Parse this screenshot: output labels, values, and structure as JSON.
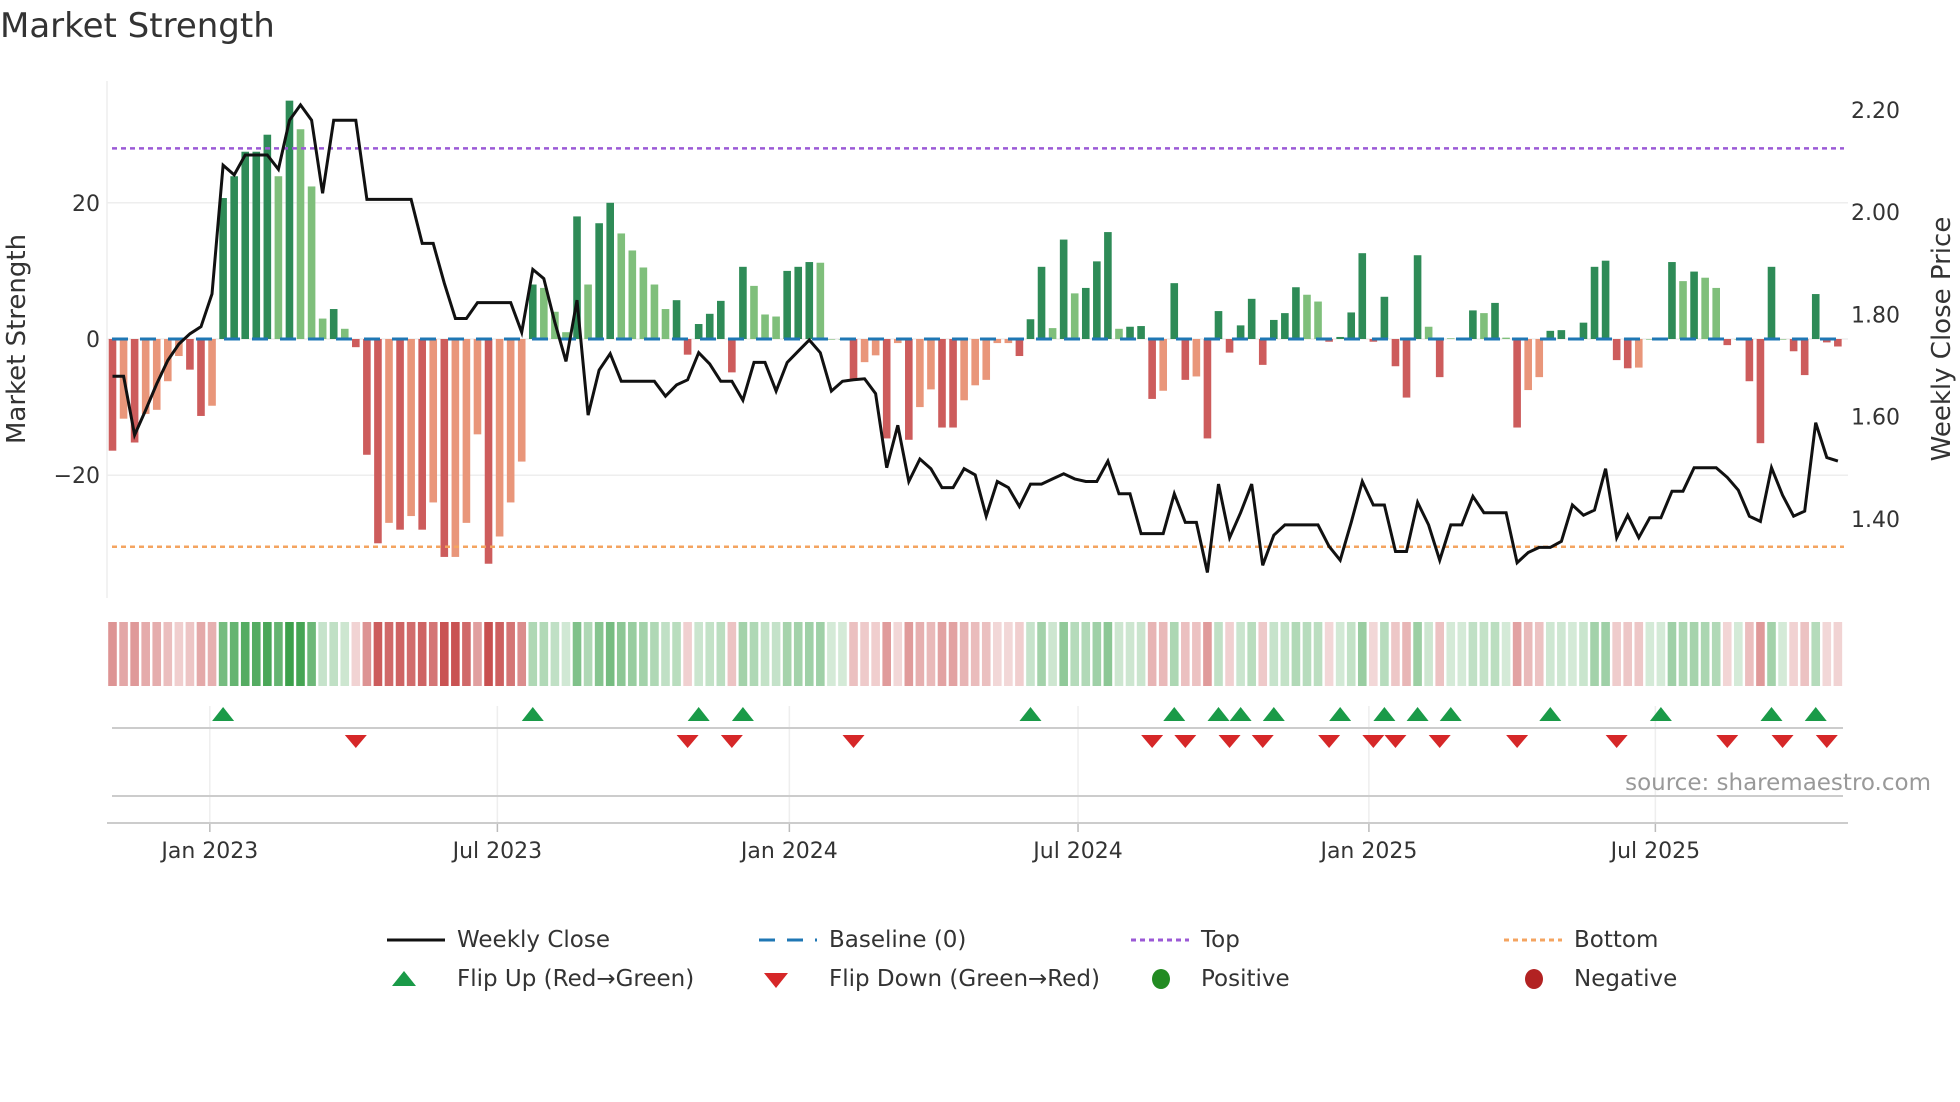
{
  "title": "Market Strength",
  "source": "source: sharemaestro.com",
  "legend": {
    "weekly_close": "Weekly Close",
    "baseline": "Baseline (0)",
    "top": "Top",
    "bottom": "Bottom",
    "flip_up": "Flip Up (Red→Green)",
    "flip_down": "Flip Down (Green→Red)",
    "positive": "Positive",
    "negative": "Negative"
  },
  "colors": {
    "dark_green": "#2e8b57",
    "light_green": "#7fbf7b",
    "red": "#cd5c5c",
    "orange": "#e9967a",
    "baseline": "#1f77b4",
    "top": "#9b59d6",
    "bottom": "#f4a460",
    "flip_up": "#1a9a48",
    "flip_down": "#d62728",
    "positive": "#228b22",
    "negative": "#b22222",
    "close": "#111111"
  },
  "chart_data": {
    "type": "bar",
    "title": "Market Strength",
    "ylabel": "Market Strength",
    "y2label": "Weekly Close Price",
    "ylim": [
      -38,
      38
    ],
    "y2lim": [
      1.225,
      2.3
    ],
    "yticks": [
      {
        "v": 20,
        "label": "20"
      },
      {
        "v": 0,
        "label": "0"
      },
      {
        "v": -20,
        "label": "−20"
      }
    ],
    "y2ticks": [
      {
        "v": 2.2,
        "label": "2.20"
      },
      {
        "v": 2.0,
        "label": "2.00"
      },
      {
        "v": 1.8,
        "label": "1.80"
      },
      {
        "v": 1.6,
        "label": "1.60"
      },
      {
        "v": 1.4,
        "label": "1.40"
      }
    ],
    "xticks": [
      {
        "week": 8.8,
        "label": "Jan 2023"
      },
      {
        "week": 34.8,
        "label": "Jul 2023"
      },
      {
        "week": 61.2,
        "label": "Jan 2024"
      },
      {
        "week": 87.3,
        "label": "Jul 2024"
      },
      {
        "week": 113.6,
        "label": "Jan 2025"
      },
      {
        "week": 139.5,
        "label": "Jul 2025"
      }
    ],
    "top_level": 28,
    "bottom_level": -30.5,
    "baseline": 0,
    "strength": [
      -16.4,
      -11.7,
      -15.2,
      -11,
      -10.4,
      -6.2,
      -2.5,
      -4.5,
      -11.3,
      -9.8,
      20.7,
      23.9,
      27.5,
      27.5,
      30,
      23.9,
      35,
      30.8,
      22.4,
      3,
      4.4,
      1.5,
      -1.2,
      -17,
      -30,
      -27,
      -28,
      -26,
      -28,
      -24,
      -32,
      -32,
      -27,
      -14,
      -33,
      -29,
      -24,
      -18,
      8,
      7.5,
      4,
      1,
      18,
      8,
      17,
      20,
      15.5,
      13,
      10.5,
      8,
      4.4,
      5.7,
      -2.3,
      2.2,
      3.7,
      5.6,
      -4.9,
      10.6,
      7.8,
      3.6,
      3.3,
      10,
      10.6,
      11.3,
      11.2,
      0,
      0,
      -5.9,
      -3.4,
      -2.4,
      -14.6,
      -0.6,
      -14.8,
      -10,
      -7.4,
      -13,
      -13,
      -9,
      -6.8,
      -6,
      -0.6,
      -0.6,
      -2.5,
      2.9,
      10.6,
      1.6,
      14.6,
      6.7,
      7.5,
      11.4,
      15.7,
      1.5,
      1.8,
      1.9,
      -8.8,
      -7.6,
      8.2,
      -6,
      -5.5,
      -14.6,
      4.1,
      -2,
      2,
      5.9,
      -3.8,
      2.8,
      3.8,
      7.6,
      6.5,
      5.5,
      -0.4,
      0.3,
      3.9,
      12.6,
      -0.4,
      6.2,
      -4,
      -8.6,
      12.3,
      1.8,
      -5.6,
      0.1,
      0.2,
      4.2,
      3.8,
      5.3,
      0.2,
      -13,
      -7.5,
      -5.6,
      1.2,
      1.3,
      0.2,
      2.4,
      10.6,
      11.5,
      -3.1,
      -4.3,
      -4.2,
      0,
      0,
      11.3,
      8.5,
      9.9,
      9,
      7.5,
      -0.9,
      0,
      -6.2,
      -15.3,
      10.6,
      0,
      -1.8,
      -5.3,
      6.6,
      -0.5,
      -1.1
    ],
    "shade": "RrRrrrrRRrGGGGGgGgggGgRRRrRrRrRrrrRrrrGgggGgGGgggggGRGGGRGgggGGGgggRrrRrRrrRRrrrrrRGGgGgGGGgGGRrGRrRGRGGRGGGggRGGGRGRRGgRgGGgGgRrrGGgGGGRRrggGgGggRgRRGgRRGRR",
    "close": [
      1.679,
      1.679,
      1.564,
      1.613,
      1.664,
      1.71,
      1.742,
      1.762,
      1.776,
      1.84,
      2.092,
      2.073,
      2.112,
      2.112,
      2.112,
      2.084,
      2.18,
      2.21,
      2.18,
      2.037,
      2.18,
      2.18,
      2.18,
      2.025,
      2.025,
      2.025,
      2.025,
      2.025,
      1.939,
      1.939,
      1.861,
      1.792,
      1.792,
      1.823,
      1.823,
      1.823,
      1.823,
      1.765,
      1.888,
      1.87,
      1.784,
      1.708,
      1.828,
      1.603,
      1.691,
      1.723,
      1.669,
      1.669,
      1.669,
      1.669,
      1.64,
      1.662,
      1.672,
      1.725,
      1.703,
      1.669,
      1.669,
      1.632,
      1.706,
      1.706,
      1.65,
      1.706,
      1.728,
      1.75,
      1.725,
      1.65,
      1.669,
      1.672,
      1.674,
      1.645,
      1.5,
      1.583,
      1.473,
      1.517,
      1.498,
      1.461,
      1.461,
      1.498,
      1.486,
      1.405,
      1.473,
      1.461,
      1.424,
      1.468,
      1.468,
      1.478,
      1.488,
      1.478,
      1.473,
      1.473,
      1.513,
      1.449,
      1.449,
      1.371,
      1.371,
      1.371,
      1.449,
      1.393,
      1.393,
      1.295,
      1.468,
      1.363,
      1.412,
      1.468,
      1.309,
      1.368,
      1.388,
      1.388,
      1.388,
      1.388,
      1.346,
      1.319,
      1.393,
      1.473,
      1.427,
      1.427,
      1.336,
      1.336,
      1.432,
      1.388,
      1.319,
      1.388,
      1.388,
      1.444,
      1.412,
      1.412,
      1.412,
      1.314,
      1.334,
      1.344,
      1.344,
      1.356,
      1.427,
      1.407,
      1.417,
      1.498,
      1.363,
      1.407,
      1.363,
      1.402,
      1.402,
      1.454,
      1.454,
      1.5,
      1.5,
      1.5,
      1.481,
      1.456,
      1.405,
      1.395,
      1.5,
      1.446,
      1.405,
      1.415,
      1.588,
      1.52,
      1.513
    ],
    "flip_up_weeks": [
      10,
      38,
      53,
      57,
      83,
      96,
      100,
      102,
      105,
      111,
      115,
      118,
      121,
      130,
      140,
      150,
      154
    ],
    "flip_down_weeks": [
      22,
      52,
      56,
      67,
      94,
      97,
      101,
      104,
      110,
      114,
      116,
      120,
      127,
      136,
      146,
      151,
      155
    ],
    "legend_position": "bottom-center"
  }
}
